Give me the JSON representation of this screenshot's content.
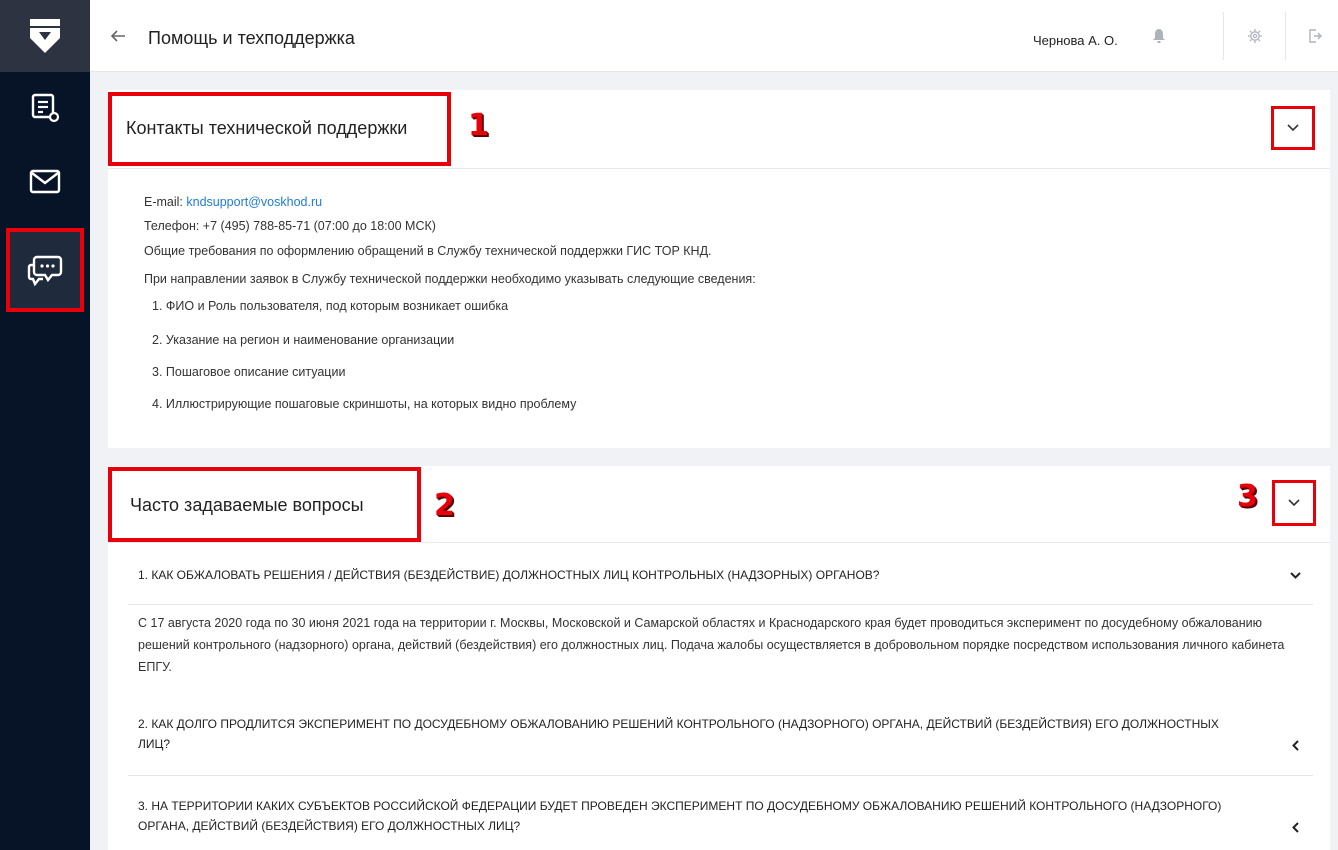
{
  "topbar": {
    "title": "Помощь и техподдержка",
    "user": "Чернова А. О."
  },
  "contacts": {
    "title": "Контакты технической поддержки",
    "email_label": "E-mail: ",
    "email": "kndsupport@voskhod.ru",
    "phone": "Телефон: +7 (495) 788-85-71 (07:00 до 18:00 МСК)",
    "requirements": "Общие требования по оформлению обращений в Службу технической поддержки ГИС ТОР КНД.",
    "intro": "При направлении заявок в Службу технической поддержки необходимо указывать следующие сведения:",
    "items": [
      "1. ФИО и Роль пользователя, под которым возникает ошибка",
      "2. Указание на регион и наименование организации",
      "3. Пошаговое описание ситуации",
      "4. Иллюстрирующие пошаговые скриншоты, на которых видно проблему"
    ]
  },
  "faq": {
    "title": "Часто задаваемые вопросы",
    "questions": [
      "1. КАК ОБЖАЛОВАТЬ РЕШЕНИЯ / ДЕЙСТВИЯ (БЕЗДЕЙСТВИЕ) ДОЛЖНОСТНЫХ ЛИЦ КОНТРОЛЬНЫХ (НАДЗОРНЫХ) ОРГАНОВ?",
      "2. КАК ДОЛГО ПРОДЛИТСЯ ЭКСПЕРИМЕНТ ПО ДОСУДЕБНОМУ ОБЖАЛОВАНИЮ РЕШЕНИЙ КОНТРОЛЬНОГО (НАДЗОРНОГО) ОРГАНА, ДЕЙСТВИЙ (БЕЗДЕЙСТВИЯ) ЕГО ДОЛЖНОСТНЫХ ЛИЦ?",
      "3. НА ТЕРРИТОРИИ КАКИХ СУБЪЕКТОВ РОССИЙСКОЙ ФЕДЕРАЦИИ БУДЕТ ПРОВЕДЕН ЭКСПЕРИМЕНТ ПО ДОСУДЕБНОМУ ОБЖАЛОВАНИЮ РЕШЕНИЙ КОНТРОЛЬНОГО (НАДЗОРНОГО) ОРГАНА, ДЕЙСТВИЙ (БЕЗДЕЙСТВИЯ) ЕГО ДОЛЖНОСТНЫХ ЛИЦ?"
    ],
    "answer1": "С 17 августа 2020 года по 30 июня 2021 года на территории г. Москвы, Московской и Самарской областях и Краснодарского края будет проводиться эксперимент по досудебному обжалованию решений контрольного (надзорного) органа, действий (бездействия) его должностных лиц. Подача жалобы осуществляется в добровольном порядке посредством использования личного кабинета ЕПГУ."
  },
  "annotations": [
    "1",
    "2",
    "3"
  ],
  "icons": {
    "logo": "shield-logo-icon",
    "nav": [
      "registry-icon",
      "mail-icon",
      "support-chat-icon"
    ],
    "topbar": [
      "back-arrow-icon",
      "bell-icon",
      "gear-icon",
      "logout-icon"
    ]
  },
  "colors": {
    "sidebar": "#071427",
    "annotation": "#e8000b",
    "link": "#1e7dd6"
  }
}
